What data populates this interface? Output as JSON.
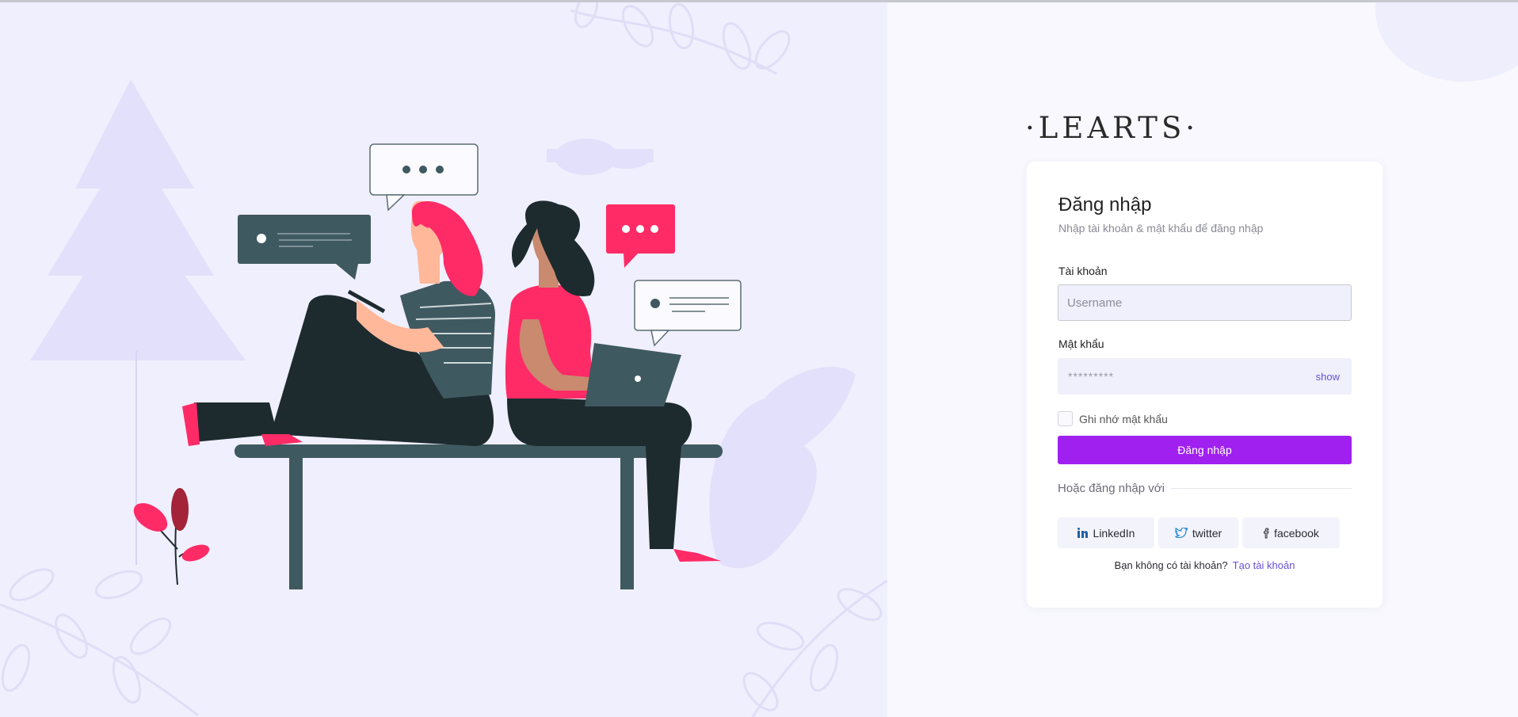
{
  "brand": {
    "logo_text": "·LEARTS·"
  },
  "login": {
    "title": "Đăng nhập",
    "subtitle": "Nhập tài khoản & mật khẩu để đăng nhập",
    "username_label": "Tài khoản",
    "username_placeholder": "Username",
    "password_label": "Mật khẩu",
    "password_value": "*********",
    "show_label": "show",
    "remember_label": "Ghi nhớ mật khẩu",
    "submit_label": "Đăng nhập",
    "or_label": "Hoặc đăng nhập với"
  },
  "social": [
    {
      "label": "LinkedIn",
      "icon": "linkedin-icon"
    },
    {
      "label": "twitter",
      "icon": "twitter-icon"
    },
    {
      "label": "facebook",
      "icon": "facebook-icon"
    }
  ],
  "signup": {
    "prompt": "Bạn không có tài khoản?",
    "link": "Tạo tài khoản"
  },
  "colors": {
    "accent": "#a020f0",
    "link": "#6a4fd8",
    "left_bg": "#f0effd",
    "right_bg": "#f8f8fe",
    "illustration_dark": "#1d2b2f",
    "illustration_pink": "#ff2b66"
  }
}
